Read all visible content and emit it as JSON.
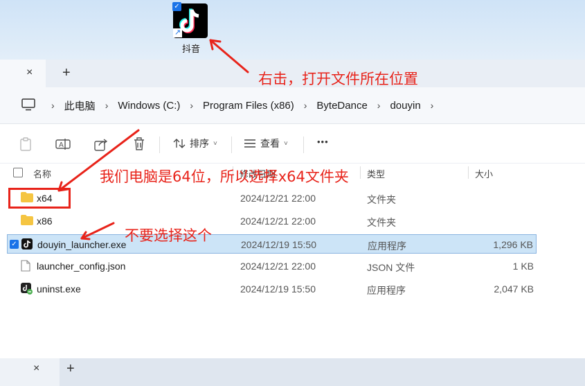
{
  "desktop": {
    "shortcut_label": "抖音"
  },
  "window_tabs": {
    "close_glyph": "×",
    "new_glyph": "+"
  },
  "address": {
    "crumbs": [
      "此电脑",
      "Windows (C:)",
      "Program Files (x86)",
      "ByteDance",
      "douyin"
    ],
    "separator": "›"
  },
  "commands": {
    "sort_label": "排序",
    "view_label": "查看",
    "more_label": "•••",
    "chevron": "˅"
  },
  "columns": {
    "name": "名称",
    "date": "修改日期",
    "type": "类型",
    "size": "大小"
  },
  "files": [
    {
      "name": "x64",
      "date": "2024/12/21 22:00",
      "type": "文件夹",
      "size": "",
      "icon": "folder-icon"
    },
    {
      "name": "x86",
      "date": "2024/12/21 22:00",
      "type": "文件夹",
      "size": "",
      "icon": "folder-icon"
    },
    {
      "name": "douyin_launcher.exe",
      "date": "2024/12/19 15:50",
      "type": "应用程序",
      "size": "1,296 KB",
      "icon": "douyin-app-icon",
      "selected": true
    },
    {
      "name": "launcher_config.json",
      "date": "2024/12/21 22:00",
      "type": "JSON 文件",
      "size": "1 KB",
      "icon": "document-icon"
    },
    {
      "name": "uninst.exe",
      "date": "2024/12/19 15:50",
      "type": "应用程序",
      "size": "2,047 KB",
      "icon": "uninstaller-icon"
    }
  ],
  "annotations": {
    "right_click": "右击，打开文件所在位置",
    "choose_x64": "我们电脑是64位，所以选择x64文件夹",
    "dont_choose": "不要选择这个"
  },
  "colors": {
    "annotation_red": "#e8231a",
    "selection_bg": "#cce4f7",
    "accent_blue": "#1a73e8",
    "folder_yellow": "#f5c542"
  }
}
